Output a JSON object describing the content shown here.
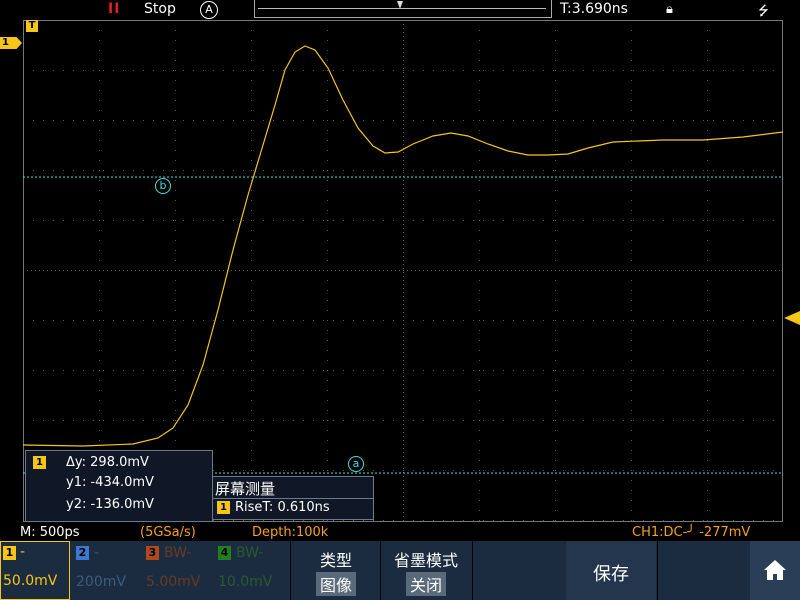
{
  "top_bar": {
    "run_indicator": "II",
    "status": "Stop",
    "acquire_mode": "A",
    "trigger_time": "T:3.690ns",
    "icons": [
      "pause-icon",
      "acquire-mode-icon",
      "lock-icon",
      "usb-icon"
    ]
  },
  "markers": {
    "trigger_position": "T",
    "ch1_reference": "1",
    "cursor_a": "a",
    "cursor_b": "b"
  },
  "measure_box": {
    "channel": "1",
    "delta_y": "Δy: 298.0mV",
    "y1": "y1: -434.0mV",
    "y2": "y2: -136.0mV"
  },
  "screen_measure": {
    "title": "屏幕测量",
    "channel": "1",
    "rise_time": "RiseT: 0.610ns"
  },
  "info_bar": {
    "timebase": "M: 500ps",
    "sample_rate": "(5GSa/s)",
    "depth": "Depth:100k",
    "trigger": "CH1:DC-╯  -277mV"
  },
  "channels": [
    {
      "num": "1",
      "coupling": "-",
      "scale": "50.0mV",
      "active": true
    },
    {
      "num": "2",
      "coupling": "-",
      "scale": "200mV",
      "active": false
    },
    {
      "num": "3",
      "coupling": "BW-",
      "scale": "5.00mV",
      "active": false
    },
    {
      "num": "4",
      "coupling": "BW-",
      "scale": "10.0mV",
      "active": false
    }
  ],
  "menu": {
    "type_label": "类型",
    "type_value": "图像",
    "persist_label": "省墨模式",
    "persist_value": "关闭",
    "save_label": "保存"
  },
  "colors": {
    "ch1": "#f5c518",
    "cursor": "#40e0e0",
    "status_red": "#e0201f",
    "orange_text": "#f5a020",
    "menu_bg": "#1c2c40"
  }
}
